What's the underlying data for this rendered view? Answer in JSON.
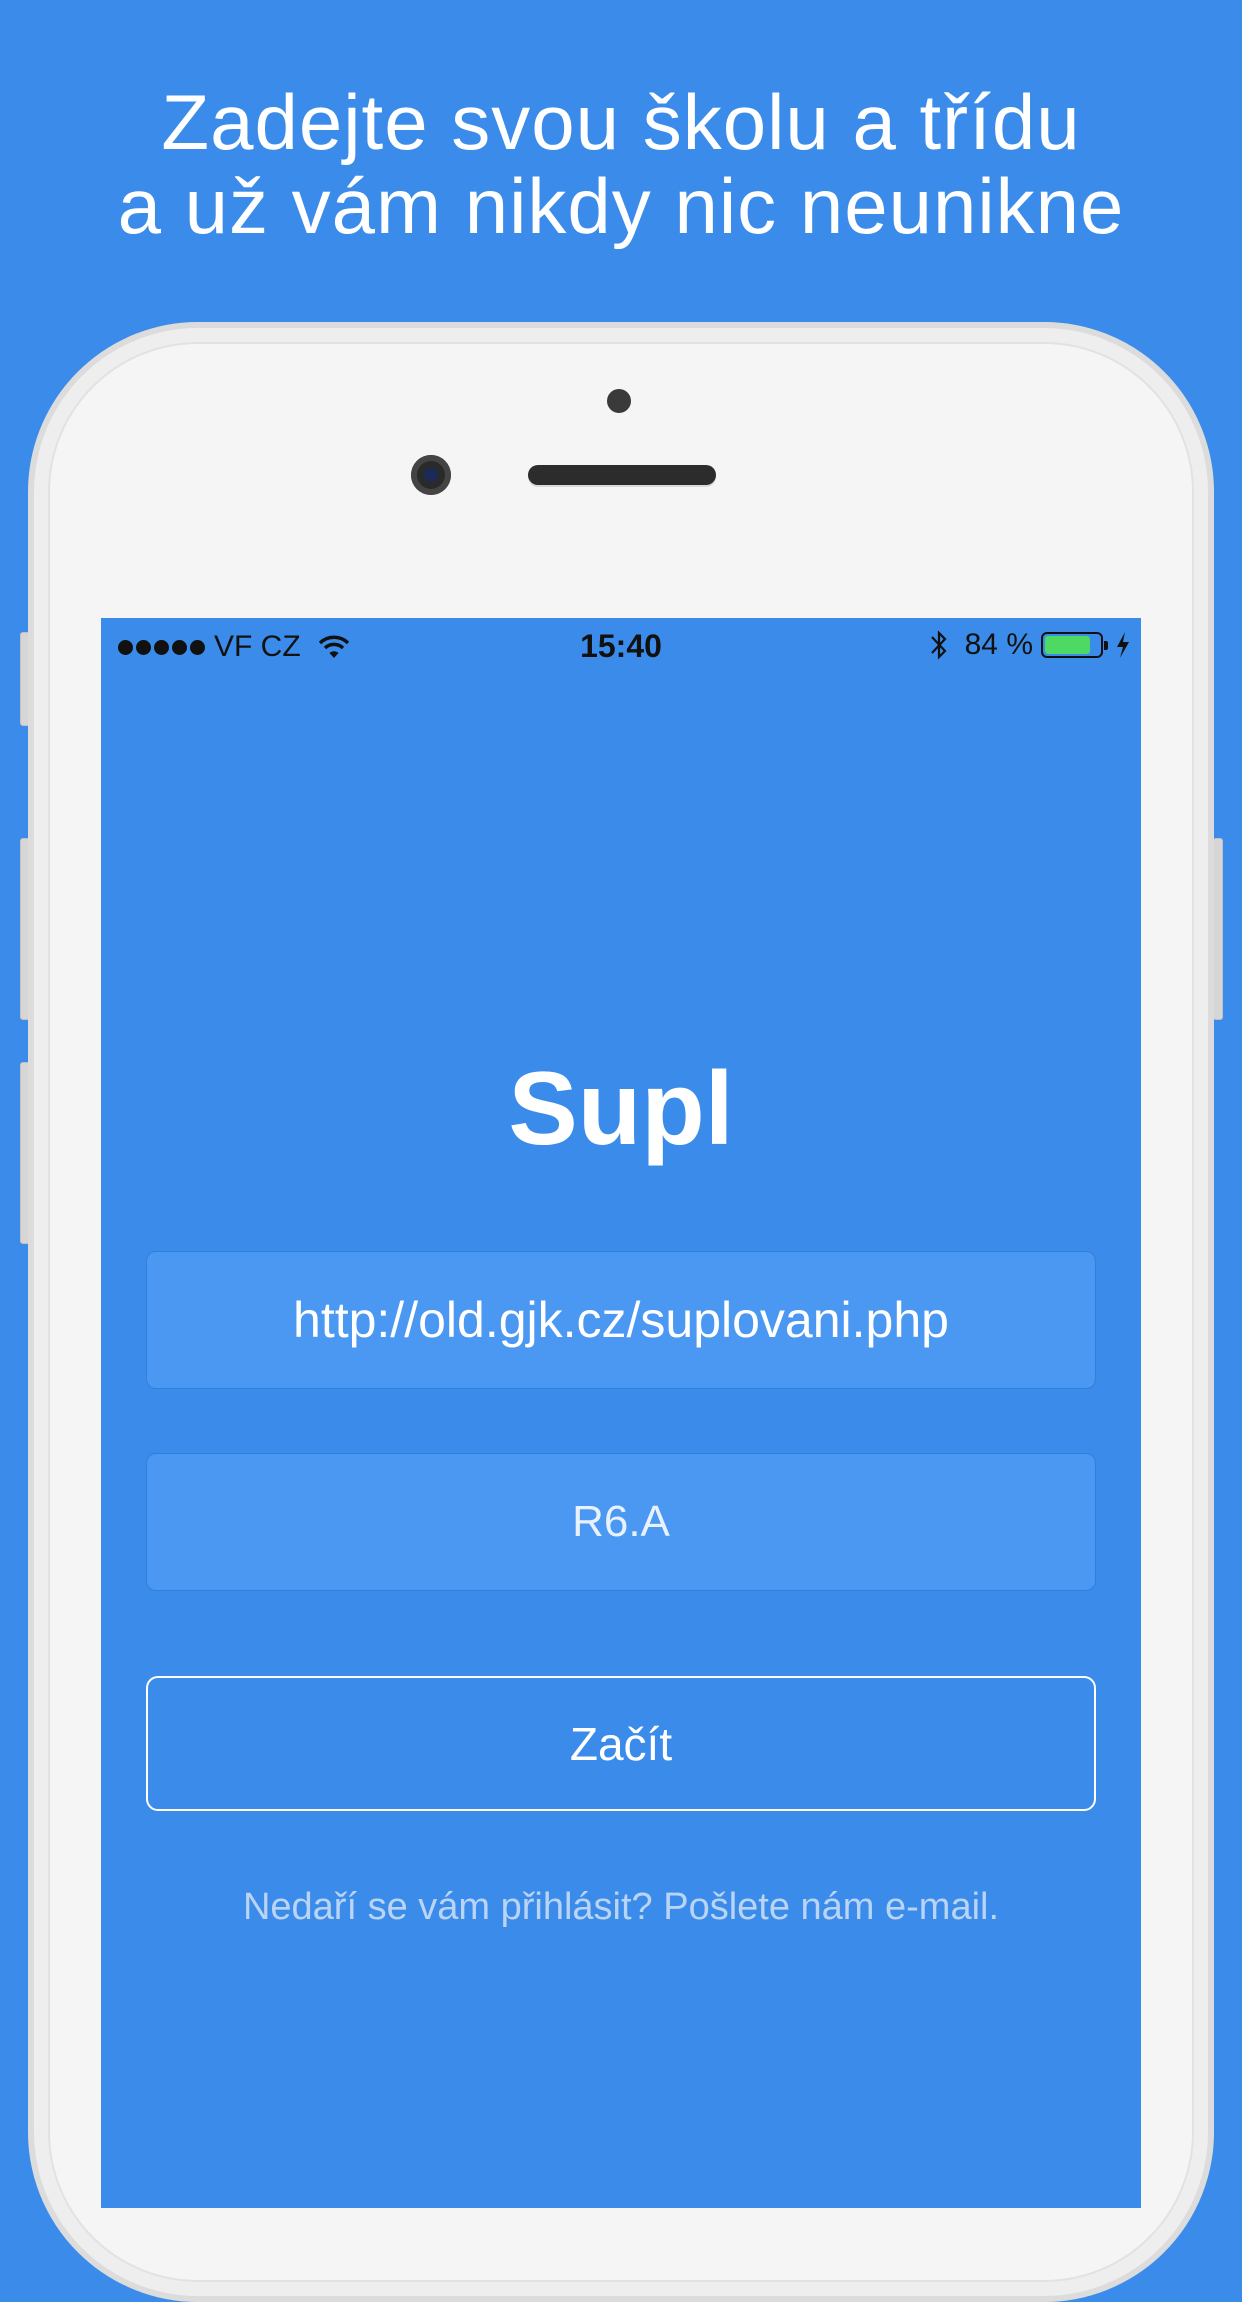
{
  "headline": {
    "line1": "Zadejte svou školu a třídu",
    "line2": "a už vám nikdy nic neunikne"
  },
  "status_bar": {
    "carrier": "VF CZ",
    "time": "15:40",
    "battery_percent": "84 %",
    "battery_level": 0.84,
    "icons": [
      "signal-dots",
      "wifi-icon",
      "bluetooth-icon",
      "battery-icon",
      "charging-bolt-icon"
    ]
  },
  "app": {
    "title": "Supl",
    "school_url_value": "http://old.gjk.cz/suplovani.php",
    "class_value": "R6.A",
    "start_button_label": "Začít",
    "help_text": "Nedaří se vám přihlásit? Pošlete nám e-mail."
  },
  "colors": {
    "background": "#3b8cea",
    "field_background": "#4a98f2",
    "battery_fill": "#4cd964"
  }
}
